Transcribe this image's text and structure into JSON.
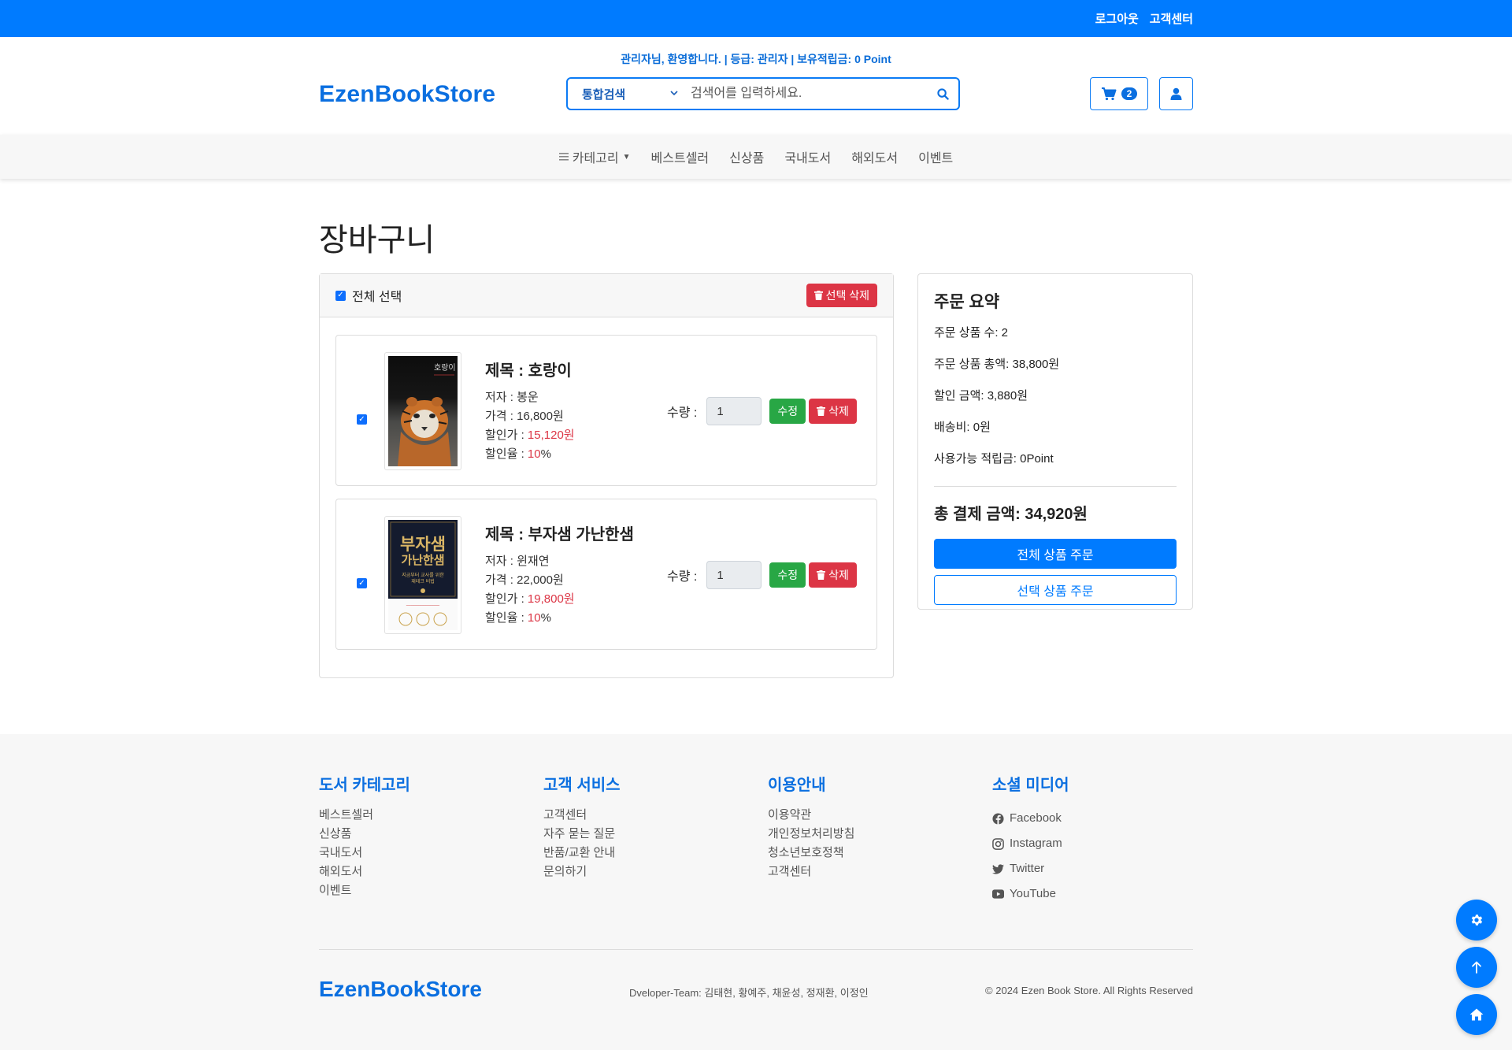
{
  "topbar": {
    "logout": "로그아웃",
    "customer_center": "고객센터"
  },
  "header": {
    "welcome": "관리자님, 환영합니다. | 등급: 관리자 | 보유적립금: 0 Point",
    "logo": "EzenBookStore",
    "search_select": "통합검색",
    "search_placeholder": "검색어를 입력하세요.",
    "cart_count": "2"
  },
  "nav": {
    "category": "카테고리",
    "items": [
      "베스트셀러",
      "신상품",
      "국내도서",
      "해외도서",
      "이벤트"
    ]
  },
  "page": {
    "title": "장바구니"
  },
  "cart": {
    "select_all": "전체 선택",
    "delete_selected": "선택 삭제",
    "items": [
      {
        "title": "제목 : 호랑이",
        "author_label": "저자 : 봉운",
        "price_label": "가격 : 16,800원",
        "discount_price_prefix": "할인가 : ",
        "discount_price": "15,120원",
        "discount_rate_prefix": "할인율 : ",
        "discount_rate": "10",
        "discount_rate_suffix": "%",
        "qty_label": "수량 :",
        "qty": "1",
        "edit": "수정",
        "delete": "삭제"
      },
      {
        "title": "제목 : 부자샘 가난한샘",
        "author_label": "저자 : 윈재연",
        "price_label": "가격 : 22,000원",
        "discount_price_prefix": "할인가 : ",
        "discount_price": "19,800원",
        "discount_rate_prefix": "할인율 : ",
        "discount_rate": "10",
        "discount_rate_suffix": "%",
        "qty_label": "수량 :",
        "qty": "1",
        "edit": "수정",
        "delete": "삭제"
      }
    ]
  },
  "summary": {
    "title": "주문 요약",
    "item_count": "주문 상품 수: 2",
    "total_price": "주문 상품 총액: 38,800원",
    "discount": "할인 금액: 3,880원",
    "shipping": "배송비: 0원",
    "points": "사용가능 적립금: 0Point",
    "grand_total": "총 결제 금액: 34,920원",
    "order_all": "전체 상품 주문",
    "order_selected": "선택 상품 주문"
  },
  "footer": {
    "col1": {
      "title": "도서 카테고리",
      "links": [
        "베스트셀러",
        "신상품",
        "국내도서",
        "해외도서",
        "이벤트"
      ]
    },
    "col2": {
      "title": "고객 서비스",
      "links": [
        "고객센터",
        "자주 묻는 질문",
        "반품/교환 안내",
        "문의하기"
      ]
    },
    "col3": {
      "title": "이용안내",
      "links": [
        "이용약관",
        "개인정보처리방침",
        "청소년보호정책",
        "고객센터"
      ]
    },
    "col4": {
      "title": "소셜 미디어",
      "links": [
        "Facebook",
        "Instagram",
        "Twitter",
        "YouTube"
      ]
    },
    "logo": "EzenBookStore",
    "developers": "Dveloper-Team: 김태현, 황예주, 채윤성, 정재환, 이정인",
    "copyright": "© 2024 Ezen Book Store. All Rights Reserved"
  },
  "book_covers": [
    {
      "title_art": "호랑이"
    },
    {
      "title_art": "부자샘 가난한샘",
      "subtitle_art": "지금부터 교사를 위한 재테크 비법"
    }
  ]
}
